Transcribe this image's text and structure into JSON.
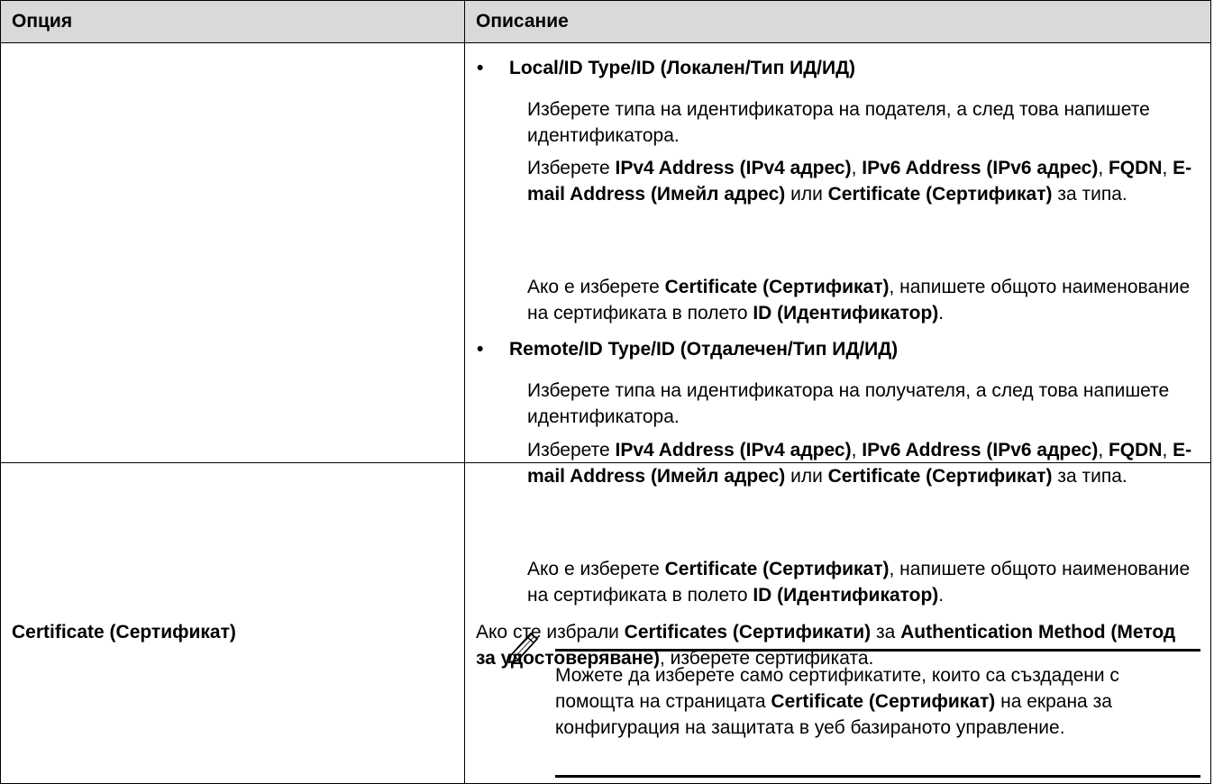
{
  "header": {
    "col_option": "Опция",
    "col_description": "Описание"
  },
  "row1": {
    "local": {
      "title": "Local/ID Type/ID (Локален/Тип ИД/ИД)",
      "p1": "Изберете типа на идентификатора на подателя, а след това напишете идентификатора.",
      "p2_a": "Изберете ",
      "p2_b1": "IPv4 Address (IPv4 адрес)",
      "p2_c": ", ",
      "p2_b2": "IPv6 Address (IPv6 адрес)",
      "p2_d": ", ",
      "p2_b3": "FQDN",
      "p2_e": ", ",
      "p2_b4": "E-mail Address (Имейл адрес)",
      "p2_f": " или ",
      "p2_b5": "Certificate (Сертификат)",
      "p2_g": " за типа.",
      "p3_a": "Ако е изберете ",
      "p3_b1": "Certificate (Сертификат)",
      "p3_c": ", напишете общото наименование на сертификата в полето ",
      "p3_b2": "ID (Идентификатор)",
      "p3_d": "."
    },
    "remote": {
      "title": "Remote/ID Type/ID (Отдалечен/Тип ИД/ИД)",
      "p1": "Изберете типа на идентификатора на получателя, а след това напишете идентификатора.",
      "p2_a": "Изберете ",
      "p2_b1": "IPv4 Address (IPv4 адрес)",
      "p2_c": ", ",
      "p2_b2": "IPv6 Address (IPv6 адрес)",
      "p2_d": ", ",
      "p2_b3": "FQDN",
      "p2_e": ", ",
      "p2_b4": "E-mail Address (Имейл адрес)",
      "p2_f": " или ",
      "p2_b5": "Certificate (Сертификат)",
      "p2_g": " за типа.",
      "p3_a": "Ако е изберете ",
      "p3_b1": "Certificate (Сертификат)",
      "p3_c": ", напишете общото наименование на сертификата в полето ",
      "p3_b2": "ID (Идентификатор)",
      "p3_d": "."
    }
  },
  "row2": {
    "option": "Certificate (Сертификат)",
    "d_a": "Ако сте избрали ",
    "d_b1": "Certificates (Сертификати)",
    "d_c": " за ",
    "d_b2": "Authentication Method (Метод за удостоверяване)",
    "d_d": ", изберете сертификата.",
    "note_a": "Можете да изберете само сертификатите, които са създадени с помощта на страницата ",
    "note_b": "Certificate (Сертификат)",
    "note_c": " на екрана за конфигурация на защитата в уеб базираното управление."
  },
  "note_icon": "pencil-note-icon"
}
